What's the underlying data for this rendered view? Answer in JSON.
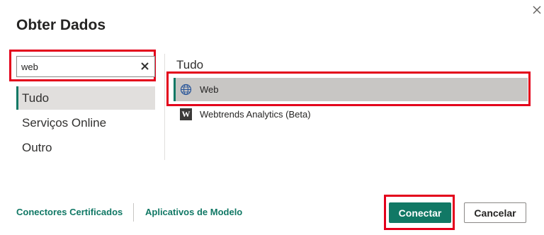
{
  "dialog": {
    "title": "Obter Dados",
    "close_icon": "close-icon"
  },
  "search": {
    "value": "web",
    "clear_icon": "clear-x-icon"
  },
  "categories": [
    {
      "label": "Tudo",
      "selected": true
    },
    {
      "label": "Serviços Online",
      "selected": false
    },
    {
      "label": "Outro",
      "selected": false
    }
  ],
  "results": {
    "heading": "Tudo",
    "items": [
      {
        "label": "Web",
        "icon": "globe-icon",
        "selected": true
      },
      {
        "label": "Webtrends Analytics (Beta)",
        "icon": "webtrends-w-icon",
        "icon_letter": "W",
        "selected": false
      }
    ]
  },
  "footer": {
    "links": [
      "Conectores Certificados",
      "Aplicativos de Modelo"
    ],
    "connect_label": "Conectar",
    "cancel_label": "Cancelar"
  },
  "colors": {
    "accent": "#117865",
    "highlight_box": "#e3001b",
    "selected_category_bg": "#e1dfdd",
    "selected_result_bg": "#c8c6c4"
  }
}
